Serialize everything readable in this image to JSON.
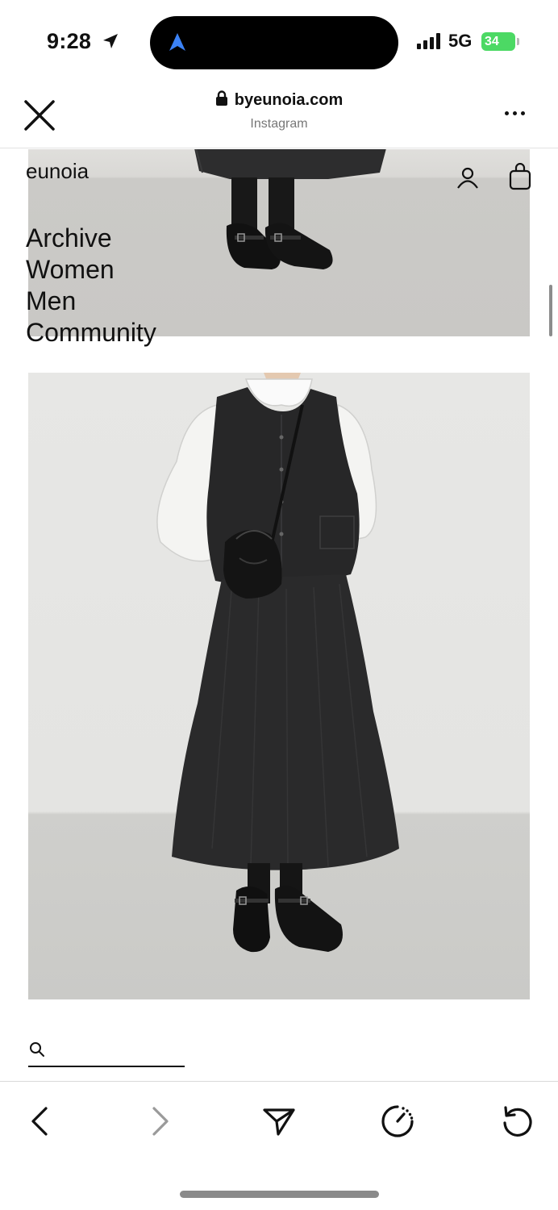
{
  "status_bar": {
    "time": "9:28",
    "network": "5G",
    "battery": "34",
    "icons": [
      "location-arrow-icon",
      "navigation-app-icon",
      "cellular-signal-icon",
      "battery-icon"
    ]
  },
  "browser": {
    "domain": "byeunoia.com",
    "subtitle": "Instagram",
    "icons": [
      "close-icon",
      "lock-icon",
      "more-icon"
    ]
  },
  "site": {
    "brand": "eunoia",
    "nav": [
      "Archive",
      "Women",
      "Men",
      "Community"
    ],
    "header_icons": [
      "account-icon",
      "bag-icon"
    ],
    "search": {
      "placeholder": "",
      "value": ""
    }
  },
  "toolbar": {
    "buttons": [
      "back-icon",
      "forward-icon",
      "share-icon",
      "speed-dial-icon",
      "reload-icon"
    ]
  }
}
